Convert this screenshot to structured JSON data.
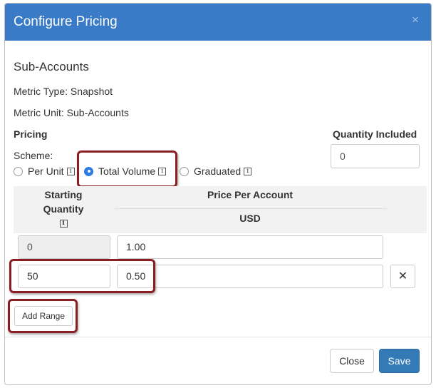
{
  "modal": {
    "title": "Configure Pricing",
    "close_glyph": "×"
  },
  "section": {
    "title": "Sub-Accounts",
    "metric_type": "Metric Type: Snapshot",
    "metric_unit": "Metric Unit: Sub-Accounts"
  },
  "pricing": {
    "label": "Pricing",
    "scheme_label": "Scheme:",
    "options": [
      {
        "label": "Per Unit",
        "selected": false
      },
      {
        "label": "Total Volume",
        "selected": true
      },
      {
        "label": "Graduated",
        "selected": false
      }
    ],
    "info_glyph": "i"
  },
  "quantity_included": {
    "label": "Quantity Included",
    "value": "0"
  },
  "table": {
    "col_start_line1": "Starting",
    "col_start_line2": "Quantity",
    "col_price": "Price Per Account",
    "col_currency": "USD",
    "rows": [
      {
        "start": "0",
        "price": "1.00"
      },
      {
        "start": "50",
        "price": "0.50"
      }
    ],
    "remove_glyph": "✕"
  },
  "buttons": {
    "add_range": "Add Range",
    "close": "Close",
    "save": "Save"
  },
  "colors": {
    "header": "#3a7bc8",
    "accent": "#337ab7",
    "highlight": "#8a1e24"
  }
}
